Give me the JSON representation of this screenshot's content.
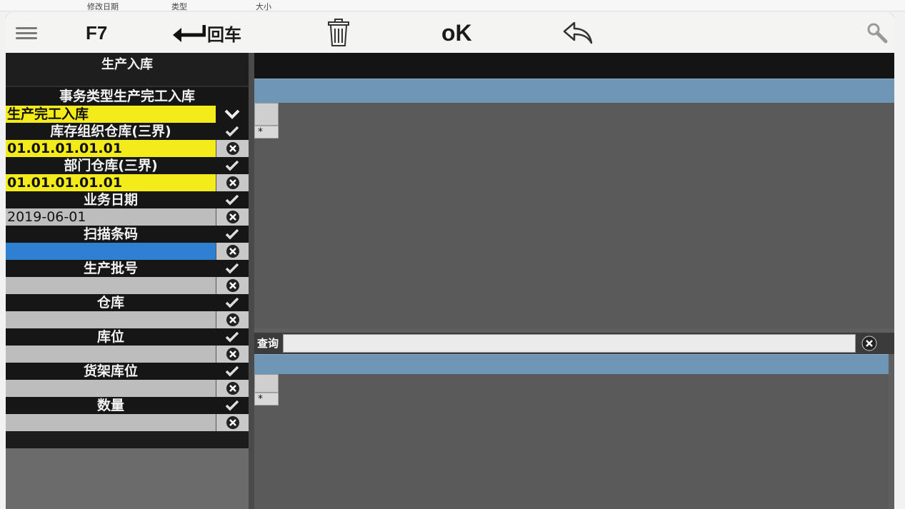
{
  "background_explorer": {
    "columns": [
      "修改日期",
      "类型",
      "大小"
    ]
  },
  "toolbar": {
    "f7_label": "F7",
    "enter_label": "回车",
    "ok_label": "oK"
  },
  "panel": {
    "title": "生产入库",
    "fields": [
      {
        "label": "事务类型生产完工入库",
        "value": "生产完工入库",
        "style": "yellow",
        "action": "dropdown"
      },
      {
        "label": "库存组织仓库(三界)",
        "value": "01.01.01.01.01",
        "style": "yellow",
        "action": "clear"
      },
      {
        "label": "部门仓库(三界)",
        "value": "01.01.01.01.01",
        "style": "yellow",
        "action": "clear"
      },
      {
        "label": "业务日期",
        "value": "2019-06-01",
        "style": "date",
        "action": "clear"
      },
      {
        "label": "扫描条码",
        "value": "",
        "style": "blue",
        "action": "clear"
      },
      {
        "label": "生产批号",
        "value": "",
        "style": "gray",
        "action": "clear"
      },
      {
        "label": "仓库",
        "value": "",
        "style": "gray",
        "action": "clear"
      },
      {
        "label": "库位",
        "value": "",
        "style": "gray",
        "action": "clear"
      },
      {
        "label": "货架库位",
        "value": "",
        "style": "gray",
        "action": "clear"
      },
      {
        "label": "数量",
        "value": "",
        "style": "gray",
        "action": "clear"
      }
    ]
  },
  "grids": {
    "new_row_marker": "*"
  },
  "query": {
    "label": "查询",
    "value": ""
  },
  "colors": {
    "yellow_field": "#f4ec1a",
    "blue_field": "#2f7fd2",
    "grid_header": "#6f95b5"
  }
}
